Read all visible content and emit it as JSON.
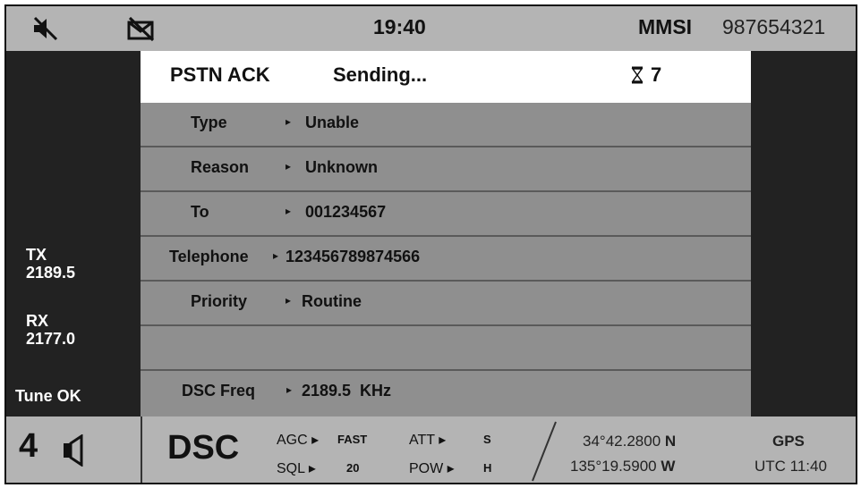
{
  "topbar": {
    "time": "19:40",
    "mmsi_label": "MMSI",
    "mmsi_value": "987654321",
    "icons": [
      "mute-icon",
      "no-mail-icon"
    ]
  },
  "side": {
    "tx_label": "TX",
    "tx_freq": "2189.5",
    "rx_label": "RX",
    "rx_freq": "2177.0",
    "tune_status": "Tune OK"
  },
  "dialog": {
    "title": "PSTN ACK",
    "status": "Sending...",
    "timer": "7",
    "rows": [
      {
        "label": "Type",
        "value": "Unable"
      },
      {
        "label": "Reason",
        "value": "Unknown"
      },
      {
        "label": "To",
        "value": "001234567"
      },
      {
        "label": "Telephone",
        "value": "123456789874566"
      },
      {
        "label": "Priority",
        "value": "Routine"
      },
      {
        "label": "",
        "value": ""
      },
      {
        "label": "DSC Freq",
        "value": "2189.5  KHz"
      }
    ]
  },
  "bottombar": {
    "channel": "4",
    "mode": "DSC",
    "agc_label": "AGC",
    "agc_value": "FAST",
    "att_label": "ATT",
    "att_value": "S",
    "sql_label": "SQL",
    "sql_value": "20",
    "pow_label": "POW",
    "pow_value": "H",
    "lat_value": "34°42.2800",
    "lat_hemi": "N",
    "lon_value": "135°19.5900",
    "lon_hemi": "W",
    "gps_label": "GPS",
    "utc_time": "UTC 11:40"
  }
}
